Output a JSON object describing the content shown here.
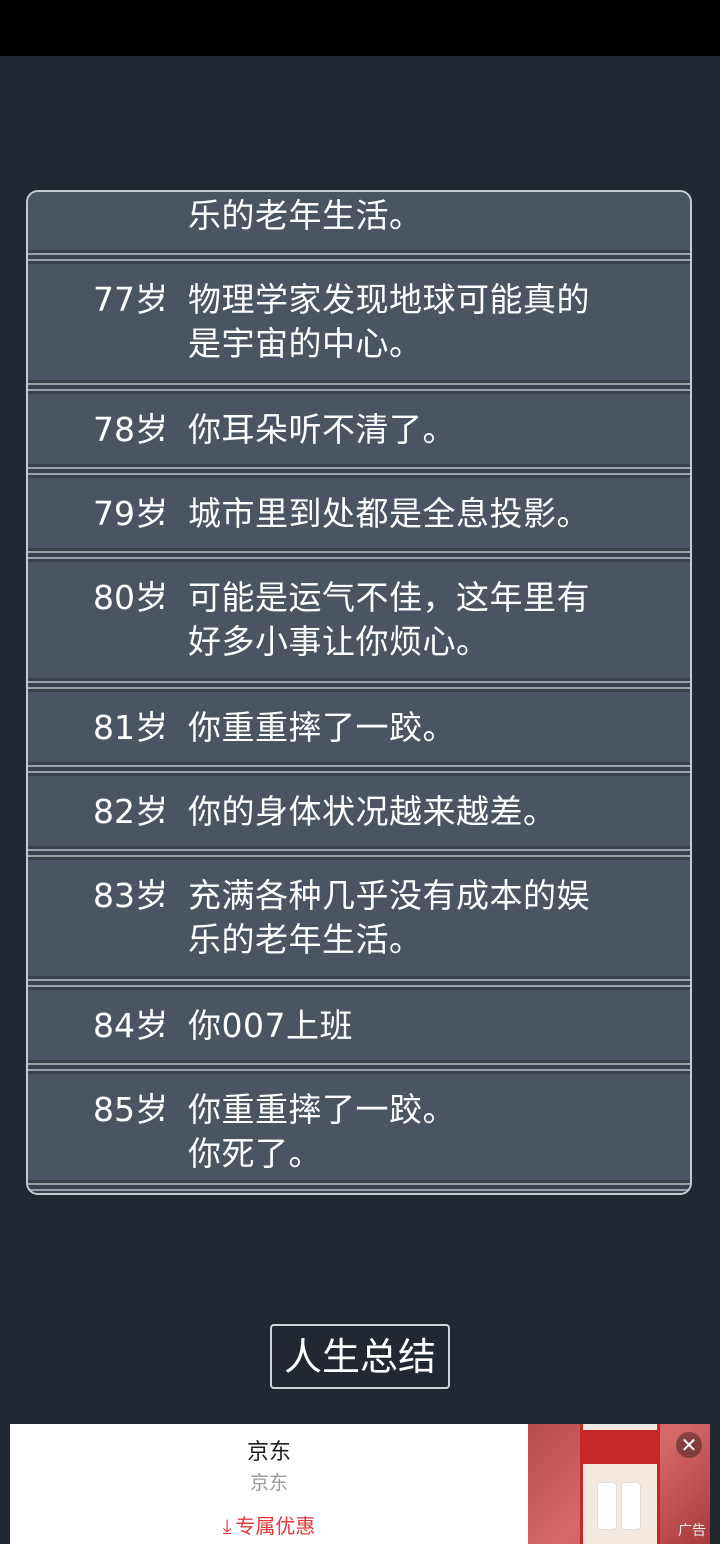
{
  "entries": [
    {
      "age": "",
      "colon": "",
      "text": "乐的老年生活。"
    },
    {
      "age": "77岁",
      "colon": ":",
      "text": "物理学家发现地球可能真的是宇宙的中心。",
      "lines": [
        "物理学家发现地球可能真的",
        "是宇宙的中心。"
      ]
    },
    {
      "age": "78岁",
      "colon": ":",
      "text": "你耳朵听不清了。"
    },
    {
      "age": "79岁",
      "colon": ":",
      "text": "城市里到处都是全息投影。"
    },
    {
      "age": "80岁",
      "colon": ":",
      "text": "可能是运气不佳，这年里有好多小事让你烦心。",
      "lines": [
        "可能是运气不佳，这年里有",
        "好多小事让你烦心。"
      ]
    },
    {
      "age": "81岁",
      "colon": ":",
      "text": "你重重摔了一跤。"
    },
    {
      "age": "82岁",
      "colon": ":",
      "text": "你的身体状况越来越差。"
    },
    {
      "age": "83岁",
      "colon": ":",
      "text": "充满各种几乎没有成本的娱乐的老年生活。",
      "lines": [
        "充满各种几乎没有成本的娱",
        "乐的老年生活。"
      ]
    },
    {
      "age": "84岁",
      "colon": ":",
      "text": "你007上班"
    },
    {
      "age": "85岁",
      "colon": ":",
      "text": "你重重摔了一跤。你死了。",
      "lines": [
        "你重重摔了一跤。",
        "你死了。"
      ]
    }
  ],
  "summary_button": "人生总结",
  "ad": {
    "title": "京东",
    "subtitle": "京东",
    "cta": "专属优惠",
    "label": "广告",
    "close": "✕"
  }
}
